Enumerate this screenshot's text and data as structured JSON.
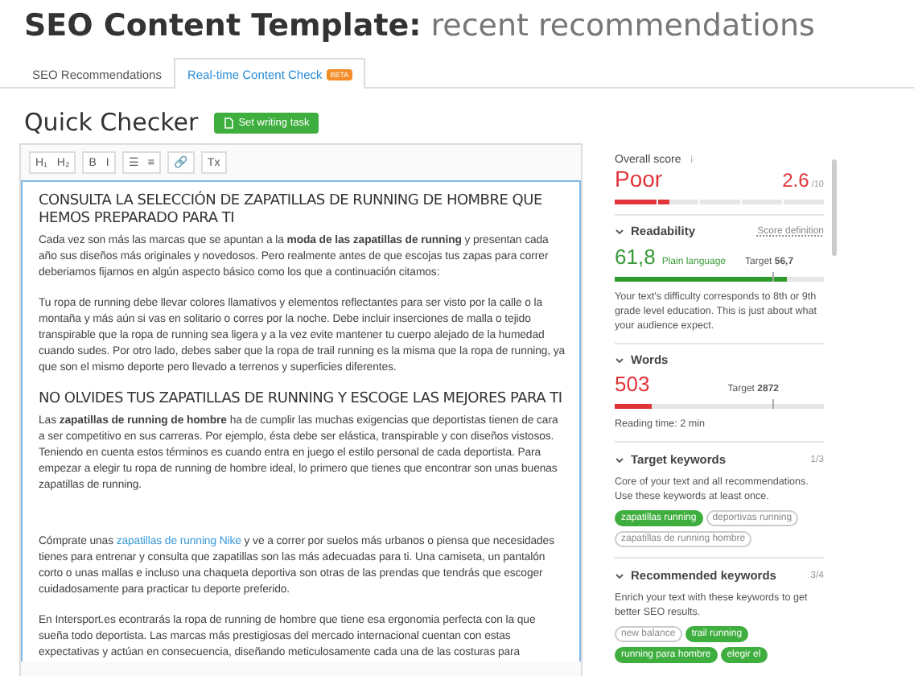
{
  "header": {
    "title": "SEO Content Template:",
    "subtitle": "recent recommendations"
  },
  "tabs": [
    {
      "label": "SEO Recommendations",
      "selected": false
    },
    {
      "label": "Real-time Content Check",
      "selected": true,
      "badge": "BETA"
    }
  ],
  "checker": {
    "title": "Quick Checker",
    "button": "Set writing task"
  },
  "toolbar": [
    "H₁",
    "H₂",
    "B",
    "I",
    "☰",
    "≡",
    "🔗",
    "Tx"
  ],
  "editor": [
    {
      "kind": "heading",
      "text": "CONSULTA LA SELECCIÓN DE ZAPATILLAS DE RUNNING DE HOMBRE QUE HEMOS PREPARADO PARA TI"
    },
    {
      "kind": "paragraph",
      "text": "Cada vez son más las marcas que se apuntan a la **moda de las zapatillas de running** y presentan cada año sus diseños más originales y novedosos. Pero realmente antes de que escojas tus zapas para correr deberiamos fijarnos en algún aspecto básico como los que a continuación citamos:"
    },
    {
      "kind": "paragraph",
      "text": "Tu ropa de running debe llevar colores llamativos y elementos reflectantes para ser visto por la calle o la montaña y más aún si vas en solitario o corres por la noche. Debe incluir inserciones de malla o tejido transpirable que la ropa de running sea ligera y a la vez evite mantener tu cuerpo alejado de la humedad cuando sudes. Por otro lado, debes saber que la ropa de trail running es la misma que la ropa de running, ya que son el mismo deporte pero llevado a terrenos y superficies diferentes."
    },
    {
      "kind": "heading",
      "text": "NO OLVIDES TUS ZAPATILLAS DE RUNNING Y ESCOGE LAS MEJORES PARA TI"
    },
    {
      "kind": "paragraph",
      "text": "Las **zapatillas de running de hombre** ha de cumplir las muchas exigencias que deportistas tienen de cara a ser competitivo en sus carreras. Por ejemplo, ésta debe ser elástica, transpirable y con diseños vistosos. Teniendo en cuenta estos términos es cuando entra en juego el estilo personal de cada deportista. Para empezar a elegir tu ropa de running de hombre ideal, lo primero que tienes que encontrar son unas buenas zapatillas de running."
    },
    {
      "kind": "blank"
    },
    {
      "kind": "link_paragraph",
      "before": "Cómprate unas",
      "link": "zapatillas de running Nike",
      "after": "y ve a correr por suelos más urbanos o piensa que necesidades tienes para entrenar y consulta que zapatillas son las más adecuadas para ti. Una camiseta, un pantalón corto o unas mallas e incluso una chaqueta deportiva son otras de las prendas que tendrás que escoger cuidadosamente para practicar tu deporte preferido."
    },
    {
      "kind": "paragraph",
      "text": "En Intersport.es econtrarás la ropa de running de hombre que tiene esa ergonomia perfecta con la que sueña todo deportista. Las marcas más prestigiosas del mercado internacional cuentan con estas expectativas y actúan en consecuencia, diseñando meticulosamente cada una de las costuras para"
    }
  ],
  "score": {
    "label": "Overall score",
    "info": "i",
    "rating": "Poor",
    "value": "2.6",
    "scale": "/10",
    "level": 0.26
  },
  "readability": {
    "title": "Readability",
    "link": "Score definition",
    "value": "61,8",
    "note": "Plain language",
    "target_label": "Target",
    "target": "56,7",
    "level": 0.82,
    "target_marker": {
      "level": 0.75
    },
    "description": "Your text's difficulty corresponds to 8th or 9th grade level education. This is just about what your audience expect."
  },
  "words": {
    "title": "Words",
    "value": "503",
    "target_label": "Target",
    "target": "2872",
    "level": 0.175,
    "target_marker": {
      "level": 0.75
    },
    "reading_time": "Reading time: 2 min"
  },
  "target_keywords": {
    "title": "Target keywords",
    "count": "1/3",
    "description": "Core of your text and all recommendations. Use these keywords at least once.",
    "keywords": [
      {
        "text": "zapatillas running",
        "used": true
      },
      {
        "text": "deportivas running",
        "used": false
      },
      {
        "text": "zapatillas de running hombre",
        "used": false
      }
    ]
  },
  "recommended_keywords": {
    "title": "Recommended keywords",
    "count": "3/4",
    "description": "Enrich your text with these keywords to get better SEO results.",
    "keywords": [
      {
        "text": "new balance",
        "used": false
      },
      {
        "text": "trail running",
        "used": true
      },
      {
        "text": "running para hombre",
        "used": true
      },
      {
        "text": "elegir el",
        "used": true
      }
    ]
  }
}
